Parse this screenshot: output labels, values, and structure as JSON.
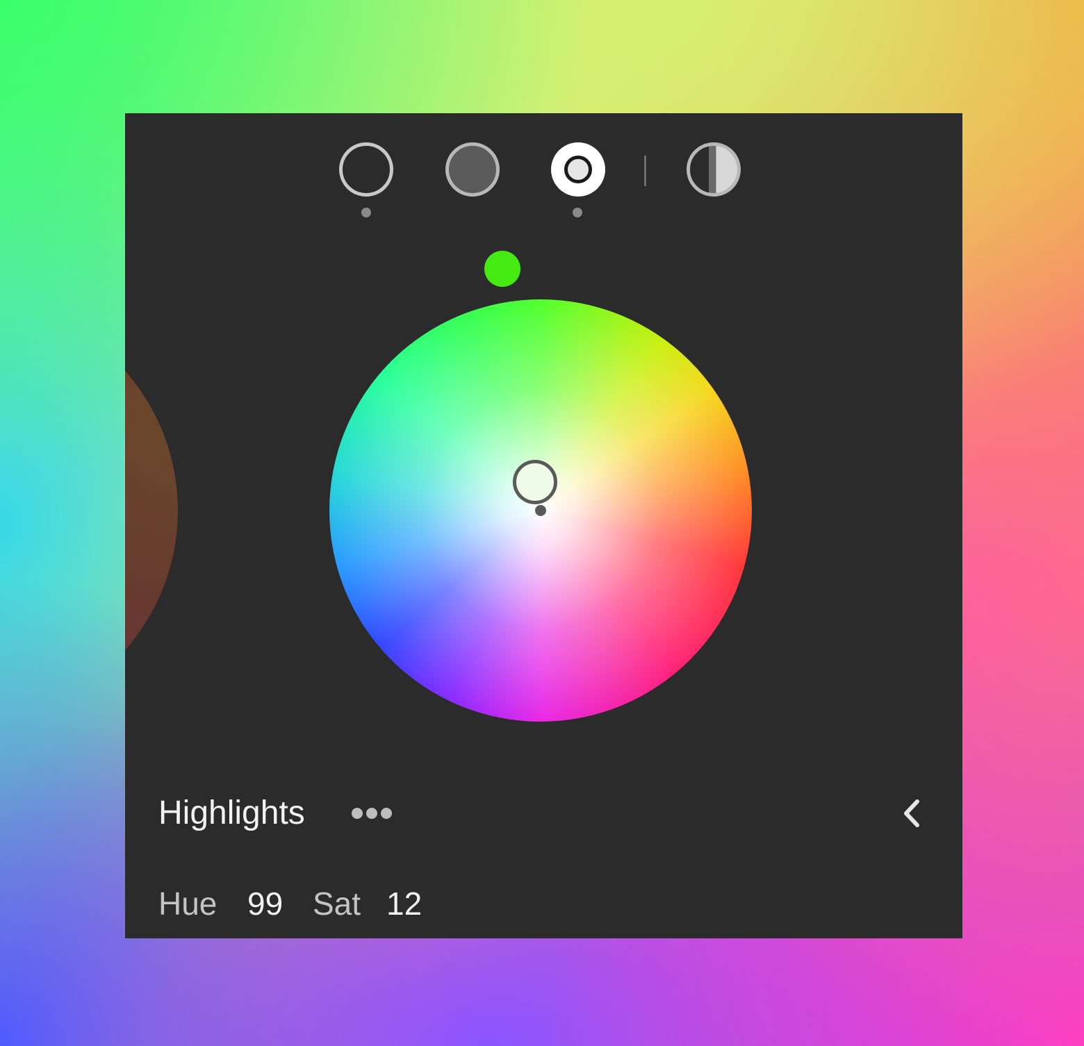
{
  "panel": {
    "region_label": "Highlights",
    "hue_label": "Hue",
    "hue_value": "99",
    "sat_label": "Sat",
    "sat_value": "12"
  },
  "modes": {
    "items": [
      {
        "icon": "global-circle-icon",
        "has_adjustment_dot": true
      },
      {
        "icon": "shadows-circle-icon",
        "has_adjustment_dot": false
      },
      {
        "icon": "highlights-circle-icon",
        "selected": true,
        "has_adjustment_dot": true
      },
      {
        "icon": "split-tone-icon",
        "has_adjustment_dot": false
      }
    ]
  },
  "wheel": {
    "hue_knob_color": "#44ea12",
    "hue": 99,
    "saturation": 12
  },
  "colors": {
    "panel_background": "#2b2b2b",
    "text_primary": "#f2f2f2",
    "text_secondary": "#c4c4c4"
  }
}
